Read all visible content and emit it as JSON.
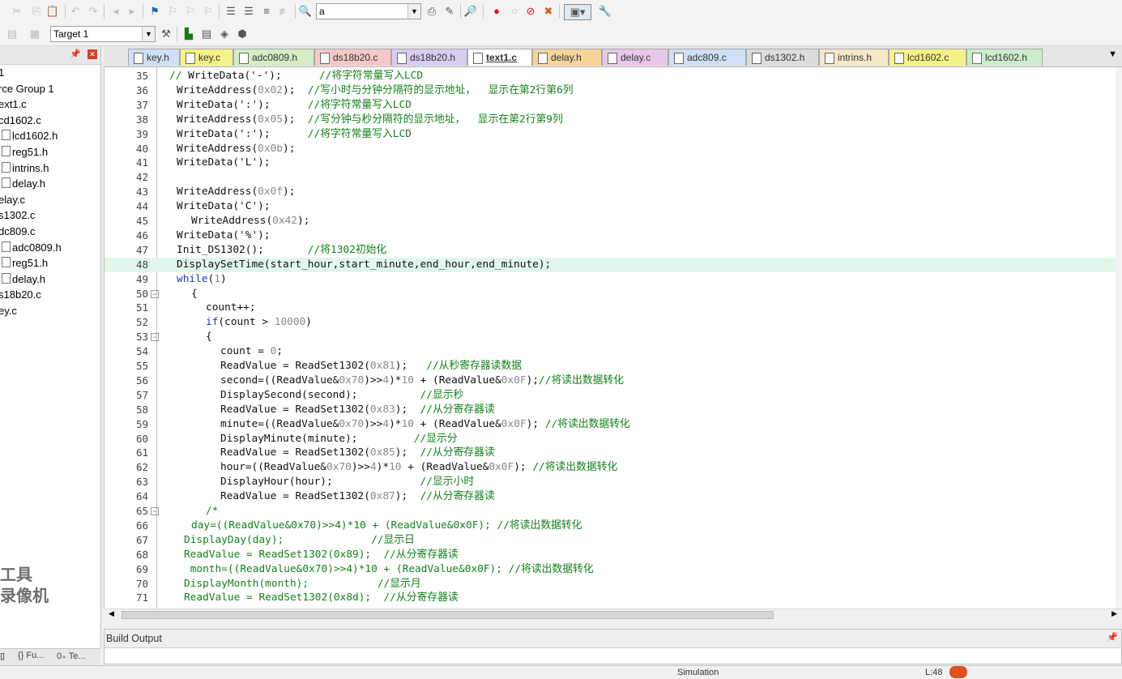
{
  "toolbar": {
    "find_value": "a",
    "target_value": "Target 1"
  },
  "project": {
    "items": [
      {
        "label": "1",
        "icon": false,
        "indent": 0
      },
      {
        "label": "rce Group 1",
        "icon": false,
        "indent": 0
      },
      {
        "label": "ext1.c",
        "icon": false,
        "indent": 0
      },
      {
        "label": "cd1602.c",
        "icon": false,
        "indent": 0
      },
      {
        "label": "lcd1602.h",
        "icon": true,
        "indent": 1
      },
      {
        "label": "reg51.h",
        "icon": true,
        "indent": 1
      },
      {
        "label": "intrins.h",
        "icon": true,
        "indent": 1
      },
      {
        "label": "delay.h",
        "icon": true,
        "indent": 1
      },
      {
        "label": "elay.c",
        "icon": false,
        "indent": 0
      },
      {
        "label": "s1302.c",
        "icon": false,
        "indent": 0
      },
      {
        "label": "dc809.c",
        "icon": false,
        "indent": 0
      },
      {
        "label": "adc0809.h",
        "icon": true,
        "indent": 1
      },
      {
        "label": "reg51.h",
        "icon": true,
        "indent": 1
      },
      {
        "label": "delay.h",
        "icon": true,
        "indent": 1
      },
      {
        "label": "s18b20.c",
        "icon": false,
        "indent": 0
      },
      {
        "label": "ey.c",
        "icon": false,
        "indent": 0
      }
    ],
    "tabs": [
      "Fu...",
      "Te..."
    ]
  },
  "file_tabs": [
    {
      "label": "key.h",
      "color": "#cfe0f5"
    },
    {
      "label": "key.c",
      "color": "#f6f28a"
    },
    {
      "label": "adc0809.h",
      "color": "#d5ecc4"
    },
    {
      "label": "ds18b20.c",
      "color": "#f5c8c8"
    },
    {
      "label": "ds18b20.h",
      "color": "#d7cdf0"
    },
    {
      "label": "text1.c",
      "color": "#ffffff",
      "active": true
    },
    {
      "label": "delay.h",
      "color": "#f7d49a"
    },
    {
      "label": "delay.c",
      "color": "#e8c8e8"
    },
    {
      "label": "adc809.c",
      "color": "#cfe0f5"
    },
    {
      "label": "ds1302.h",
      "color": "#dcdcdc"
    },
    {
      "label": "intrins.h",
      "color": "#f5e8c8"
    },
    {
      "label": "lcd1602.c",
      "color": "#f6f28a"
    },
    {
      "label": "lcd1602.h",
      "color": "#cdeccd"
    }
  ],
  "code_lines": [
    {
      "n": "35",
      "indent": 0,
      "parts": [
        [
          "c",
          "// "
        ],
        [
          "s",
          "WriteData('-');      "
        ],
        [
          "c",
          "//将字符常量写入LCD"
        ]
      ]
    },
    {
      "n": "36",
      "indent": 1,
      "parts": [
        [
          "s",
          "WriteAddress("
        ],
        [
          "n",
          "0x02"
        ],
        [
          "s",
          ");  "
        ],
        [
          "c",
          "//写小时与分钟分隔符的显示地址，  显示在第2行第6列"
        ]
      ]
    },
    {
      "n": "37",
      "indent": 1,
      "parts": [
        [
          "s",
          "WriteData(':');      "
        ],
        [
          "c",
          "//将字符常量写入LCD"
        ]
      ]
    },
    {
      "n": "38",
      "indent": 1,
      "parts": [
        [
          "s",
          "WriteAddress("
        ],
        [
          "n",
          "0x05"
        ],
        [
          "s",
          ");  "
        ],
        [
          "c",
          "//写分钟与秒分隔符的显示地址，  显示在第2行第9列"
        ]
      ]
    },
    {
      "n": "39",
      "indent": 1,
      "parts": [
        [
          "s",
          "WriteData(':');      "
        ],
        [
          "c",
          "//将字符常量写入LCD"
        ]
      ]
    },
    {
      "n": "40",
      "indent": 1,
      "parts": [
        [
          "s",
          "WriteAddress("
        ],
        [
          "n",
          "0x0b"
        ],
        [
          "s",
          ");"
        ]
      ]
    },
    {
      "n": "41",
      "indent": 1,
      "parts": [
        [
          "s",
          "WriteData('L');"
        ]
      ]
    },
    {
      "n": "42",
      "indent": 0,
      "parts": []
    },
    {
      "n": "43",
      "indent": 1,
      "parts": [
        [
          "s",
          "WriteAddress("
        ],
        [
          "n",
          "0x0f"
        ],
        [
          "s",
          ");"
        ]
      ]
    },
    {
      "n": "44",
      "indent": 1,
      "parts": [
        [
          "s",
          "WriteData('C');"
        ]
      ]
    },
    {
      "n": "45",
      "indent": 3,
      "parts": [
        [
          "s",
          "WriteAddress("
        ],
        [
          "n",
          "0x42"
        ],
        [
          "s",
          ");"
        ]
      ]
    },
    {
      "n": "46",
      "indent": 1,
      "parts": [
        [
          "s",
          "WriteData('%');"
        ]
      ]
    },
    {
      "n": "47",
      "indent": 1,
      "parts": [
        [
          "s",
          "Init_DS1302();       "
        ],
        [
          "c",
          "//将1302初始化"
        ]
      ]
    },
    {
      "n": "48",
      "indent": 1,
      "hl": true,
      "parts": [
        [
          "s",
          "DisplaySetTime(start_hour,start_minute,end_hour,end_minute);"
        ]
      ]
    },
    {
      "n": "49",
      "indent": 1,
      "parts": [
        [
          "k",
          "while"
        ],
        [
          "s",
          "("
        ],
        [
          "n",
          "1"
        ],
        [
          "s",
          ")"
        ]
      ]
    },
    {
      "n": "50",
      "indent": 3,
      "fold": true,
      "parts": [
        [
          "s",
          "{"
        ]
      ]
    },
    {
      "n": "51",
      "indent": 5,
      "parts": [
        [
          "s",
          "count++;"
        ]
      ]
    },
    {
      "n": "52",
      "indent": 5,
      "parts": [
        [
          "k",
          "if"
        ],
        [
          "s",
          "(count > "
        ],
        [
          "n",
          "10000"
        ],
        [
          "s",
          ")"
        ]
      ]
    },
    {
      "n": "53",
      "indent": 5,
      "fold": true,
      "parts": [
        [
          "s",
          "{"
        ]
      ]
    },
    {
      "n": "54",
      "indent": 7,
      "parts": [
        [
          "s",
          "count = "
        ],
        [
          "n",
          "0"
        ],
        [
          "s",
          ";"
        ]
      ]
    },
    {
      "n": "55",
      "indent": 7,
      "parts": [
        [
          "s",
          "ReadValue = ReadSet1302("
        ],
        [
          "n",
          "0x81"
        ],
        [
          "s",
          ");   "
        ],
        [
          "c",
          "//从秒寄存器读数据"
        ]
      ]
    },
    {
      "n": "56",
      "indent": 7,
      "parts": [
        [
          "s",
          "second=((ReadValue&"
        ],
        [
          "n",
          "0x70"
        ],
        [
          "s",
          ")>>"
        ],
        [
          "n",
          "4"
        ],
        [
          "s",
          ")*"
        ],
        [
          "n",
          "10"
        ],
        [
          "s",
          " + (ReadValue&"
        ],
        [
          "n",
          "0x0F"
        ],
        [
          "s",
          ");"
        ],
        [
          "c",
          "//将读出数据转化"
        ]
      ]
    },
    {
      "n": "57",
      "indent": 7,
      "parts": [
        [
          "s",
          "DisplaySecond(second);          "
        ],
        [
          "c",
          "//显示秒"
        ]
      ]
    },
    {
      "n": "58",
      "indent": 7,
      "parts": [
        [
          "s",
          "ReadValue = ReadSet1302("
        ],
        [
          "n",
          "0x83"
        ],
        [
          "s",
          ");  "
        ],
        [
          "c",
          "//从分寄存器读"
        ]
      ]
    },
    {
      "n": "59",
      "indent": 7,
      "parts": [
        [
          "s",
          "minute=((ReadValue&"
        ],
        [
          "n",
          "0x70"
        ],
        [
          "s",
          ")>>"
        ],
        [
          "n",
          "4"
        ],
        [
          "s",
          ")*"
        ],
        [
          "n",
          "10"
        ],
        [
          "s",
          " + (ReadValue&"
        ],
        [
          "n",
          "0x0F"
        ],
        [
          "s",
          "); "
        ],
        [
          "c",
          "//将读出数据转化"
        ]
      ]
    },
    {
      "n": "60",
      "indent": 7,
      "parts": [
        [
          "s",
          "DisplayMinute(minute);         "
        ],
        [
          "c",
          "//显示分"
        ]
      ]
    },
    {
      "n": "61",
      "indent": 7,
      "parts": [
        [
          "s",
          "ReadValue = ReadSet1302("
        ],
        [
          "n",
          "0x85"
        ],
        [
          "s",
          ");  "
        ],
        [
          "c",
          "//从分寄存器读"
        ]
      ]
    },
    {
      "n": "62",
      "indent": 7,
      "parts": [
        [
          "s",
          "hour=((ReadValue&"
        ],
        [
          "n",
          "0x70"
        ],
        [
          "s",
          ")>>"
        ],
        [
          "n",
          "4"
        ],
        [
          "s",
          ")*"
        ],
        [
          "n",
          "10"
        ],
        [
          "s",
          " + (ReadValue&"
        ],
        [
          "n",
          "0x0F"
        ],
        [
          "s",
          "); "
        ],
        [
          "c",
          "//将读出数据转化"
        ]
      ]
    },
    {
      "n": "63",
      "indent": 7,
      "parts": [
        [
          "s",
          "DisplayHour(hour);              "
        ],
        [
          "c",
          "//显示小时"
        ]
      ]
    },
    {
      "n": "64",
      "indent": 7,
      "parts": [
        [
          "s",
          "ReadValue = ReadSet1302("
        ],
        [
          "n",
          "0x87"
        ],
        [
          "s",
          ");  "
        ],
        [
          "c",
          "//从分寄存器读"
        ]
      ]
    },
    {
      "n": "65",
      "indent": 5,
      "fold": true,
      "parts": [
        [
          "c",
          "/*"
        ]
      ]
    },
    {
      "n": "66",
      "indent": 3,
      "parts": [
        [
          "c",
          "day=((ReadValue&0x70)>>4)*10 + (ReadValue&0x0F); //将读出数据转化"
        ]
      ]
    },
    {
      "n": "67",
      "indent": 2,
      "parts": [
        [
          "c",
          "DisplayDay(day);              //显示日"
        ]
      ]
    },
    {
      "n": "68",
      "indent": 2,
      "parts": [
        [
          "c",
          "ReadValue = ReadSet1302(0x89);  //从分寄存器读"
        ]
      ]
    },
    {
      "n": "69",
      "indent": 2,
      "parts": [
        [
          "c",
          " month=((ReadValue&0x70)>>4)*10 + (ReadValue&0x0F); //将读出数据转化"
        ]
      ]
    },
    {
      "n": "70",
      "indent": 2,
      "parts": [
        [
          "c",
          "DisplayMonth(month);           //显示月"
        ]
      ]
    },
    {
      "n": "71",
      "indent": 2,
      "parts": [
        [
          "c",
          "ReadValue = ReadSet1302(0x8d);  //从分寄存器读"
        ]
      ]
    }
  ],
  "build": {
    "title": "Build Output"
  },
  "status": {
    "mode": "Simulation",
    "position": "L:48"
  },
  "watermark": [
    "工具",
    "录像机"
  ]
}
